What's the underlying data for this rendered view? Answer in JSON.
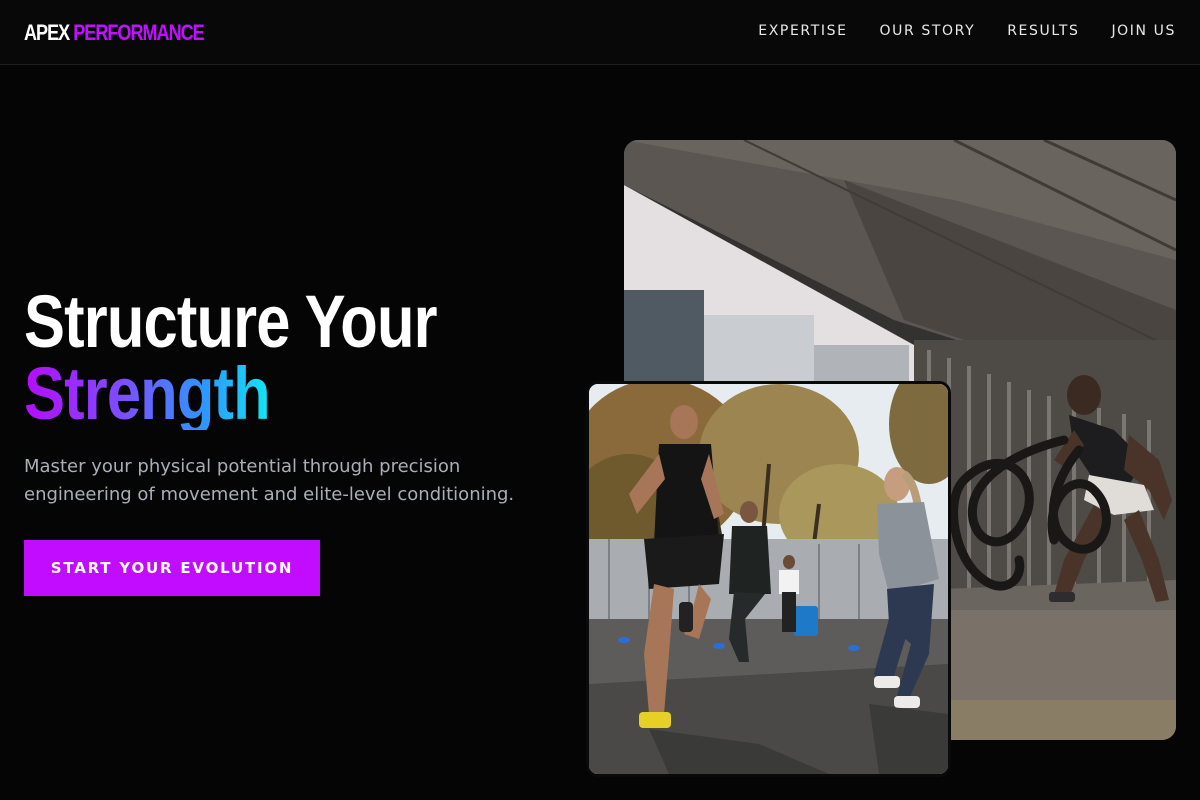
{
  "brand": {
    "name_white": "APEX",
    "name_accent": "PERFORMANCE"
  },
  "nav": {
    "items": [
      {
        "label": "EXPERTISE"
      },
      {
        "label": "OUR STORY"
      },
      {
        "label": "RESULTS"
      },
      {
        "label": "JOIN US"
      }
    ]
  },
  "hero": {
    "title_line1": "Structure Your",
    "title_line2": "Strength",
    "subtitle": "Master your physical potential through precision engineering of movement and elite-level conditioning.",
    "cta_label": "START YOUR EVOLUTION"
  },
  "colors": {
    "accent": "#c20cff",
    "background": "#050505",
    "gradient_start": "#b60cff",
    "gradient_end": "#12e6f5",
    "subtitle_text": "#a9aeb8"
  }
}
